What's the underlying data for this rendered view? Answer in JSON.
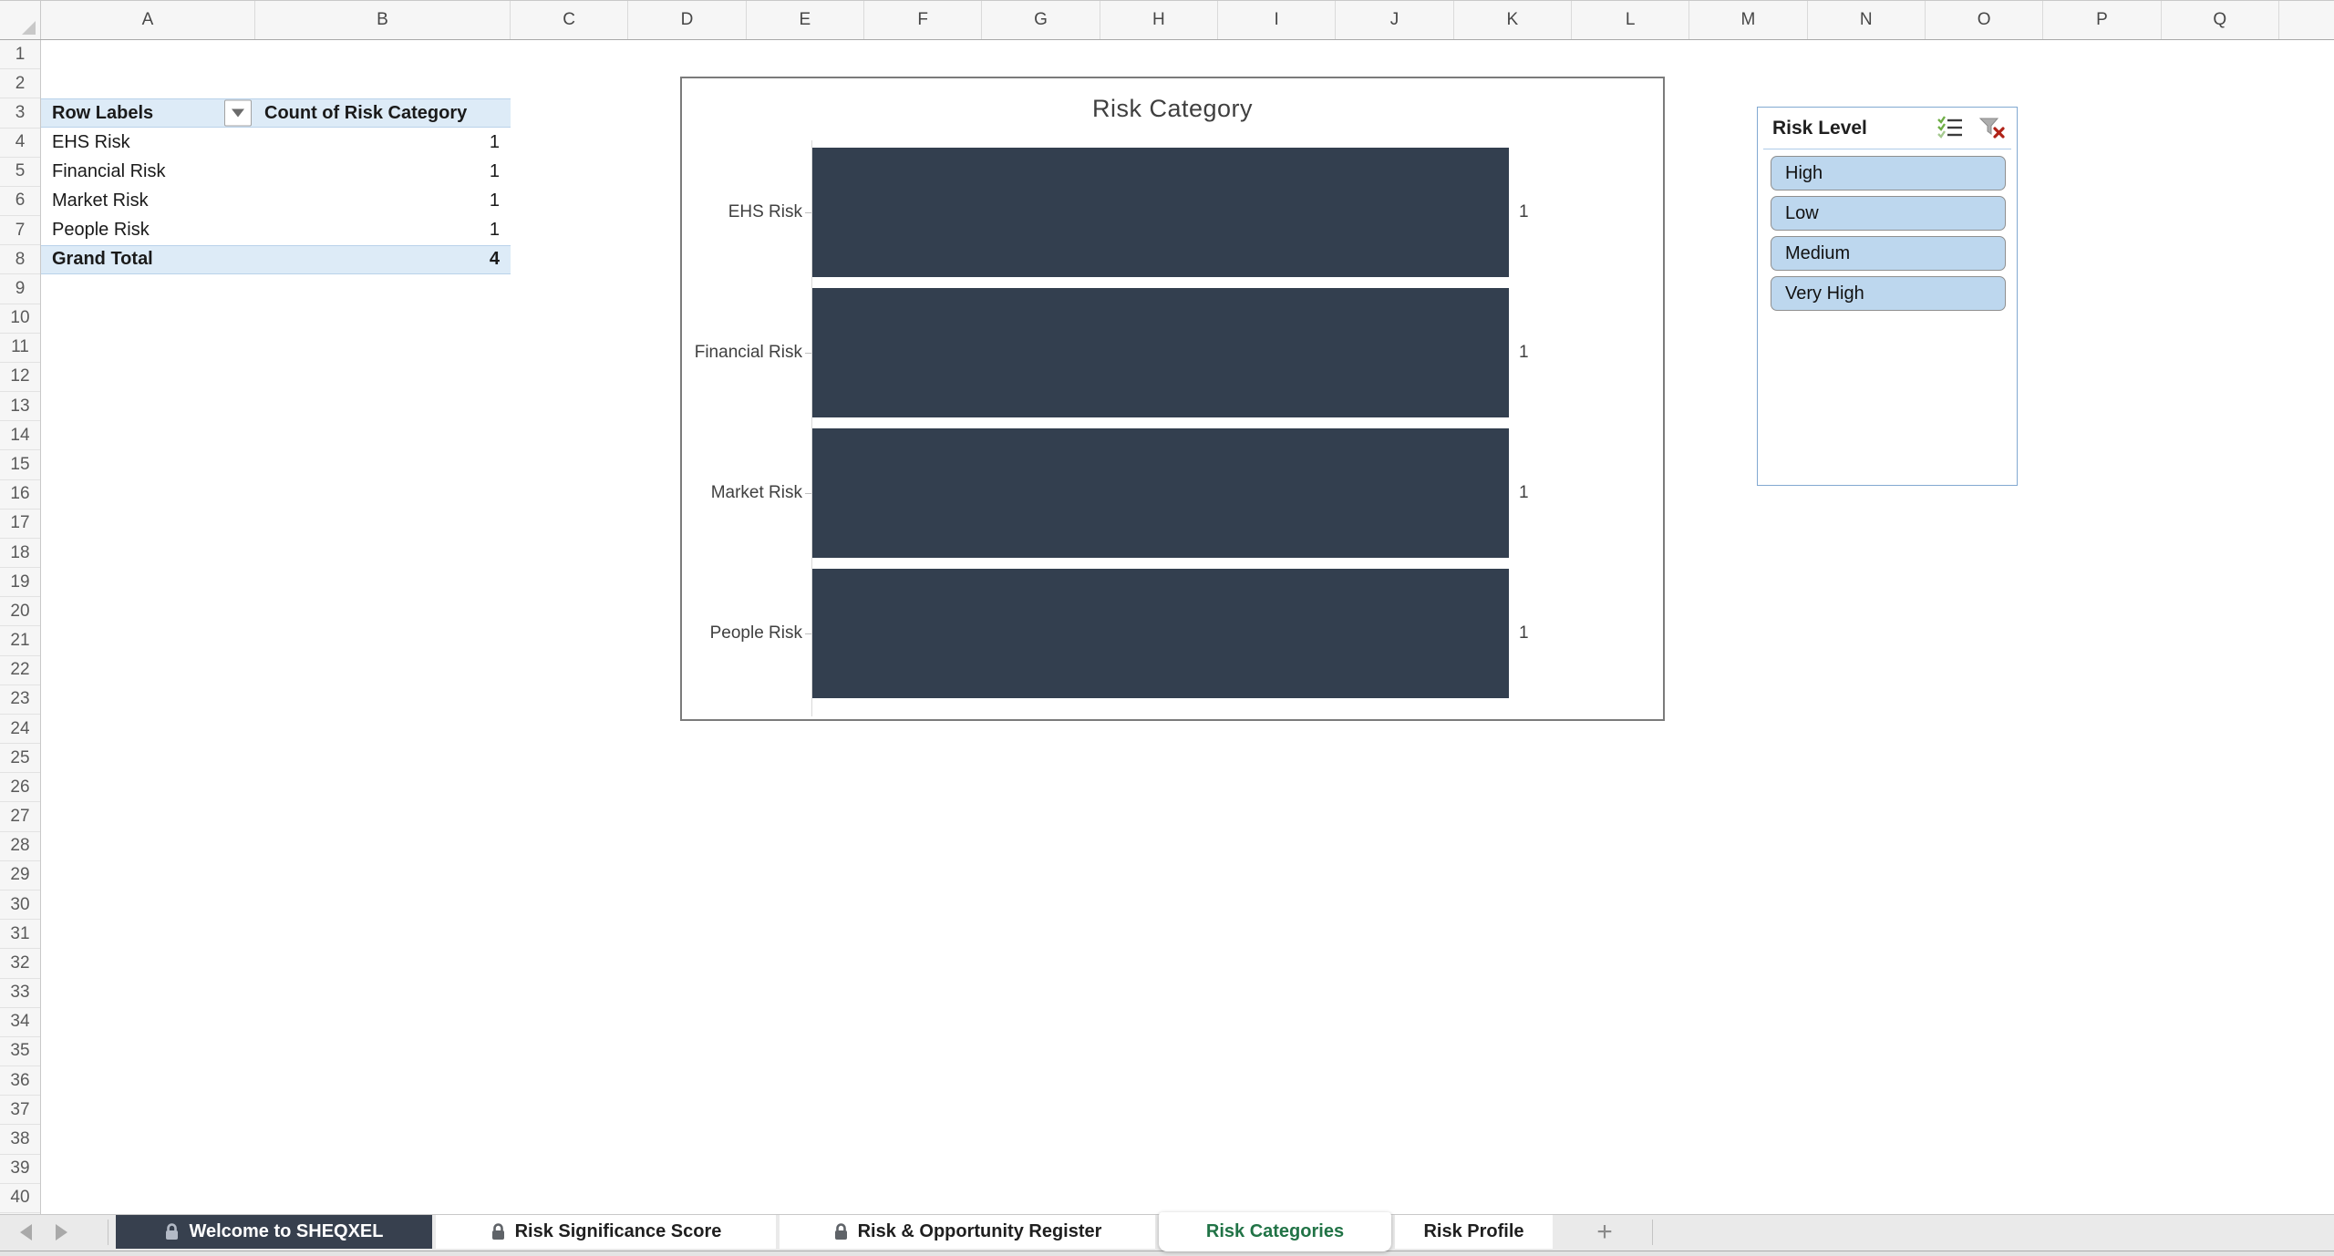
{
  "sheet": {
    "columns": [
      "A",
      "B",
      "C",
      "D",
      "E",
      "F",
      "G",
      "H",
      "I",
      "J",
      "K",
      "L",
      "M",
      "N",
      "O",
      "P",
      "Q"
    ],
    "rows": [
      "1",
      "2",
      "3",
      "4",
      "5",
      "6",
      "7",
      "8",
      "9",
      "10",
      "11",
      "12",
      "13",
      "14",
      "15",
      "16",
      "17",
      "18",
      "19",
      "20",
      "21",
      "22",
      "23",
      "24",
      "25",
      "26",
      "27",
      "28",
      "29",
      "30",
      "31",
      "32",
      "33",
      "34",
      "35",
      "36",
      "37",
      "38",
      "39",
      "40"
    ]
  },
  "pivot": {
    "row_labels_header": "Row Labels",
    "values_header": "Count of Risk Category",
    "rows": [
      {
        "label": "EHS Risk",
        "value": "1"
      },
      {
        "label": "Financial Risk",
        "value": "1"
      },
      {
        "label": "Market Risk",
        "value": "1"
      },
      {
        "label": "People Risk",
        "value": "1"
      }
    ],
    "grand_total": {
      "label": "Grand Total",
      "value": "4"
    }
  },
  "chart_data": {
    "type": "bar",
    "orientation": "horizontal",
    "title": "Risk Category",
    "categories": [
      "EHS Risk",
      "Financial Risk",
      "Market Risk",
      "People Risk"
    ],
    "values": [
      1,
      1,
      1,
      1
    ],
    "data_labels": [
      "1",
      "1",
      "1",
      "1"
    ],
    "xlim": [
      0,
      1
    ],
    "grid": false,
    "legend": false,
    "bar_color": "#333F4F"
  },
  "slicer": {
    "title": "Risk Level",
    "items": [
      {
        "label": "High",
        "selected": true
      },
      {
        "label": "Low",
        "selected": true
      },
      {
        "label": "Medium",
        "selected": true
      },
      {
        "label": "Very High",
        "selected": true
      }
    ]
  },
  "tab_bar": {
    "tabs": [
      {
        "label": "Welcome to SHEQXEL",
        "locked": true,
        "dark": true,
        "active": false
      },
      {
        "label": "Risk Significance Score",
        "locked": true,
        "dark": false,
        "active": false
      },
      {
        "label": "Risk & Opportunity Register",
        "locked": true,
        "dark": false,
        "active": false
      },
      {
        "label": "Risk Categories",
        "locked": false,
        "dark": false,
        "active": true
      },
      {
        "label": "Risk Profile",
        "locked": false,
        "dark": false,
        "active": false
      }
    ],
    "add_tab_label": "+"
  },
  "icons": {
    "filter_dropdown": "filter-dropdown-icon",
    "multi_select": "multi-select-icon",
    "clear_filter": "clear-filter-icon",
    "lock": "lock-icon",
    "prev_sheet": "prev-sheet-icon",
    "next_sheet": "next-sheet-icon",
    "add_sheet": "add-sheet-icon"
  },
  "colors": {
    "bar_fill": "#333F4F",
    "dark_tab": "#37404E",
    "active_tab_text": "#217346",
    "pivot_highlight": "#DDEBF7",
    "slicer_item_fill": "#BDD7EE",
    "slicer_border": "#82A9D1"
  }
}
